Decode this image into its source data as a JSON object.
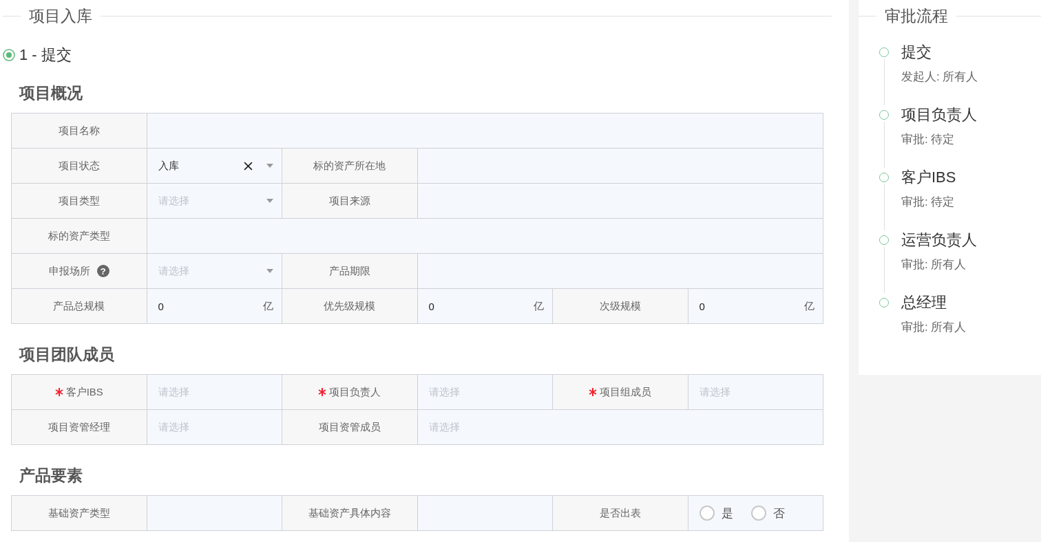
{
  "page_title": "项目入库",
  "step": {
    "label": "1 - 提交",
    "checked": true
  },
  "sections": [
    {
      "title": "项目概况",
      "rows": [
        [
          {
            "kind": "label",
            "text": "项目名称"
          },
          {
            "kind": "text"
          }
        ],
        [
          {
            "kind": "label",
            "text": "项目状态"
          },
          {
            "kind": "select",
            "value": "入库",
            "clearable": true
          },
          {
            "kind": "label",
            "text": "标的资产所在地"
          },
          {
            "kind": "text"
          }
        ],
        [
          {
            "kind": "label",
            "text": "项目类型"
          },
          {
            "kind": "select",
            "placeholder": "请选择",
            "clearable": false
          },
          {
            "kind": "label",
            "text": "项目来源"
          },
          {
            "kind": "text"
          }
        ],
        [
          {
            "kind": "label",
            "text": "标的资产类型"
          },
          {
            "kind": "text"
          }
        ],
        [
          {
            "kind": "label",
            "text": "申报场所",
            "help": "?"
          },
          {
            "kind": "select",
            "placeholder": "请选择",
            "clearable": false
          },
          {
            "kind": "label",
            "text": "产品期限"
          },
          {
            "kind": "text"
          }
        ],
        [
          {
            "kind": "label",
            "text": "产品总规模"
          },
          {
            "kind": "number",
            "value": "0",
            "unit": "亿"
          },
          {
            "kind": "label",
            "text": "优先级规模"
          },
          {
            "kind": "number",
            "value": "0",
            "unit": "亿"
          },
          {
            "kind": "label",
            "text": "次级规模"
          },
          {
            "kind": "number",
            "value": "0",
            "unit": "亿"
          }
        ]
      ]
    },
    {
      "title": "项目团队成员",
      "rows": [
        [
          {
            "kind": "label",
            "text": "客户IBS",
            "required": true
          },
          {
            "kind": "picker",
            "placeholder": "请选择"
          },
          {
            "kind": "label",
            "text": "项目负责人",
            "required": true
          },
          {
            "kind": "picker",
            "placeholder": "请选择"
          },
          {
            "kind": "label",
            "text": "项目组成员",
            "required": true
          },
          {
            "kind": "picker",
            "placeholder": "请选择"
          }
        ],
        [
          {
            "kind": "label",
            "text": "项目资管经理"
          },
          {
            "kind": "picker",
            "placeholder": "请选择"
          },
          {
            "kind": "label",
            "text": "项目资管成员"
          },
          {
            "kind": "picker",
            "placeholder": "请选择"
          }
        ]
      ]
    },
    {
      "title": "产品要素",
      "rows": [
        [
          {
            "kind": "label",
            "text": "基础资产类型"
          },
          {
            "kind": "text"
          },
          {
            "kind": "label",
            "text": "基础资产具体内容"
          },
          {
            "kind": "text"
          },
          {
            "kind": "label",
            "text": "是否出表"
          },
          {
            "kind": "radio",
            "options": [
              {
                "label": "是",
                "selected": false
              },
              {
                "label": "否",
                "selected": false
              }
            ]
          }
        ]
      ]
    }
  ],
  "approval": {
    "title": "审批流程",
    "steps": [
      {
        "title": "提交",
        "detail": "发起人: 所有人"
      },
      {
        "title": "项目负责人",
        "detail": "审批: 待定"
      },
      {
        "title": "客户IBS",
        "detail": "审批: 待定"
      },
      {
        "title": "运营负责人",
        "detail": "审批: 所有人"
      },
      {
        "title": "总经理",
        "detail": "审批: 所有人"
      }
    ]
  }
}
